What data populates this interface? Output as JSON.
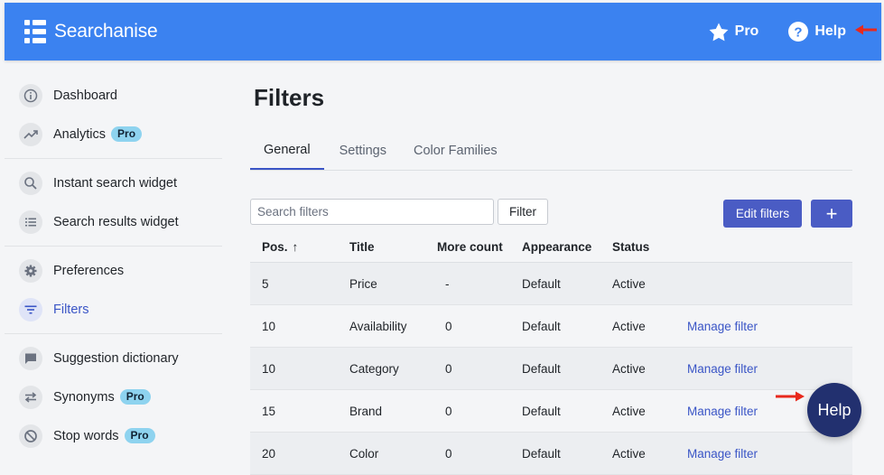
{
  "header": {
    "brand": "Searchanise",
    "pro_label": "Pro",
    "help_label": "Help",
    "accent_color": "#3b82f0"
  },
  "sidebar": {
    "items": [
      {
        "label": "Dashboard",
        "icon": "info-icon"
      },
      {
        "label": "Analytics",
        "icon": "trending-icon",
        "badge": "Pro"
      },
      {
        "label": "Instant search widget",
        "icon": "search-icon"
      },
      {
        "label": "Search results widget",
        "icon": "list-icon"
      },
      {
        "label": "Preferences",
        "icon": "gear-icon"
      },
      {
        "label": "Filters",
        "icon": "filter-icon",
        "active": true
      },
      {
        "label": "Suggestion dictionary",
        "icon": "chat-icon"
      },
      {
        "label": "Synonyms",
        "icon": "swap-icon",
        "badge": "Pro"
      },
      {
        "label": "Stop words",
        "icon": "block-icon",
        "badge": "Pro"
      }
    ]
  },
  "main": {
    "title": "Filters",
    "tabs": [
      {
        "label": "General",
        "active": true
      },
      {
        "label": "Settings"
      },
      {
        "label": "Color Families"
      }
    ],
    "search": {
      "placeholder": "Search filters",
      "value": ""
    },
    "filter_button": "Filter",
    "edit_button": "Edit filters",
    "add_button": "+",
    "table": {
      "headers": [
        "Pos.",
        "Title",
        "More count",
        "Appearance",
        "Status"
      ],
      "sort_indicator": "↑",
      "rows": [
        {
          "pos": "5",
          "title": "Price",
          "more": "-",
          "appearance": "Default",
          "status": "Active",
          "action": ""
        },
        {
          "pos": "10",
          "title": "Availability",
          "more": "0",
          "appearance": "Default",
          "status": "Active",
          "action": "Manage filter"
        },
        {
          "pos": "10",
          "title": "Category",
          "more": "0",
          "appearance": "Default",
          "status": "Active",
          "action": "Manage filter"
        },
        {
          "pos": "15",
          "title": "Brand",
          "more": "0",
          "appearance": "Default",
          "status": "Active",
          "action": "Manage filter"
        },
        {
          "pos": "20",
          "title": "Color",
          "more": "0",
          "appearance": "Default",
          "status": "Active",
          "action": "Manage filter"
        }
      ]
    }
  },
  "help_fab": {
    "label": "Help"
  }
}
